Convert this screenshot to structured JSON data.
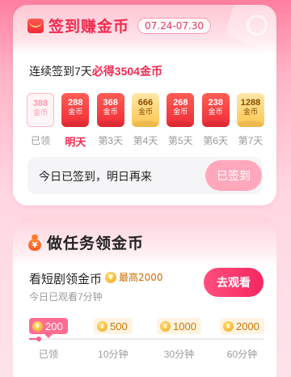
{
  "checkin": {
    "title": "签到赚金币",
    "date_range": "07.24-07.30",
    "streak_prefix": "连续签到7天",
    "streak_highlight": "必得3504金币",
    "coin_unit": "金币",
    "days": [
      {
        "amount": "388",
        "label": "已领",
        "state": "done"
      },
      {
        "amount": "288",
        "label": "明天",
        "state": "today"
      },
      {
        "amount": "368",
        "label": "第3天",
        "state": "red"
      },
      {
        "amount": "666",
        "label": "第4天",
        "state": "gold"
      },
      {
        "amount": "268",
        "label": "第5天",
        "state": "red"
      },
      {
        "amount": "238",
        "label": "第6天",
        "state": "red"
      },
      {
        "amount": "1288",
        "label": "第7天",
        "state": "gold"
      }
    ],
    "status_text": "今日已签到，明日再来",
    "signed_button": "已签到"
  },
  "tasks": {
    "title": "做任务领金币",
    "watch": {
      "name": "看短剧领金币",
      "max_label": "最高2000",
      "progress_text": "今日已观看7分钟",
      "button": "去观看",
      "progress": 0.04,
      "milestones": [
        {
          "reward": "200",
          "label": "已领",
          "state": "active"
        },
        {
          "reward": "500",
          "label": "10分钟",
          "state": "pending"
        },
        {
          "reward": "1000",
          "label": "30分钟",
          "state": "pending"
        },
        {
          "reward": "2000",
          "label": "60分钟",
          "state": "pending"
        }
      ]
    }
  },
  "colors": {
    "accent": "#f22a4f",
    "button": "#f5265f",
    "signed_disabled": "#ffa8bc",
    "coin": "#f3a417"
  },
  "icons": {
    "checkin_title": "red-envelope-icon",
    "task_title": "money-bag-icon",
    "coin": "coin-icon"
  }
}
